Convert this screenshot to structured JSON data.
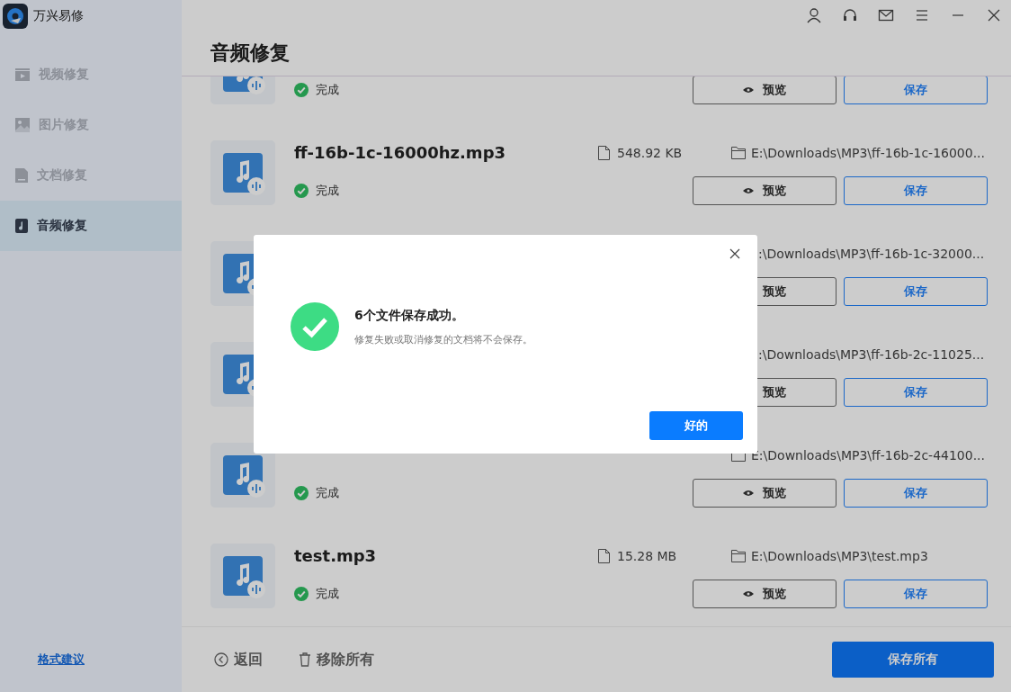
{
  "window": {
    "app_name": "万兴易修"
  },
  "sidebar": {
    "items": [
      {
        "label": "视频修复",
        "selected": false,
        "kind": "video"
      },
      {
        "label": "图片修复",
        "selected": false,
        "kind": "image"
      },
      {
        "label": "文档修复",
        "selected": false,
        "kind": "document"
      },
      {
        "label": "音频修复",
        "selected": true,
        "kind": "audio"
      }
    ],
    "footer_link": "格式建议"
  },
  "page_title": "音频修复",
  "files": [
    {
      "kind": "top_cut",
      "status": "完成",
      "preview": "预览",
      "save": "保存"
    },
    {
      "kind": "full",
      "name": "ff-16b-1c-16000hz.mp3",
      "size": "548.92 KB",
      "path": "E:\\Downloads\\MP3\\ff-16b-1c-16000...",
      "status": "完成",
      "preview": "预览",
      "save": "保存"
    },
    {
      "kind": "covered",
      "path": ":\\Downloads\\MP3\\ff-16b-1c-32000...",
      "preview": "预览",
      "save": "保存"
    },
    {
      "kind": "covered",
      "path": ":\\Downloads\\MP3\\ff-16b-2c-11025...",
      "preview": "预览",
      "save": "保存"
    },
    {
      "kind": "full",
      "path": "E:\\Downloads\\MP3\\ff-16b-2c-44100...",
      "status": "完成",
      "preview": "预览",
      "save": "保存"
    },
    {
      "kind": "full",
      "name": "test.mp3",
      "size": "15.28 MB",
      "path": "E:\\Downloads\\MP3\\test.mp3",
      "status": "完成",
      "preview": "预览",
      "save": "保存"
    }
  ],
  "footer": {
    "back": "返回",
    "remove_all": "移除所有",
    "save_all": "保存所有"
  },
  "dialog": {
    "title": "6个文件保存成功。",
    "message": "修复失败或取消修复的文档将不会保存。",
    "ok": "好的"
  }
}
